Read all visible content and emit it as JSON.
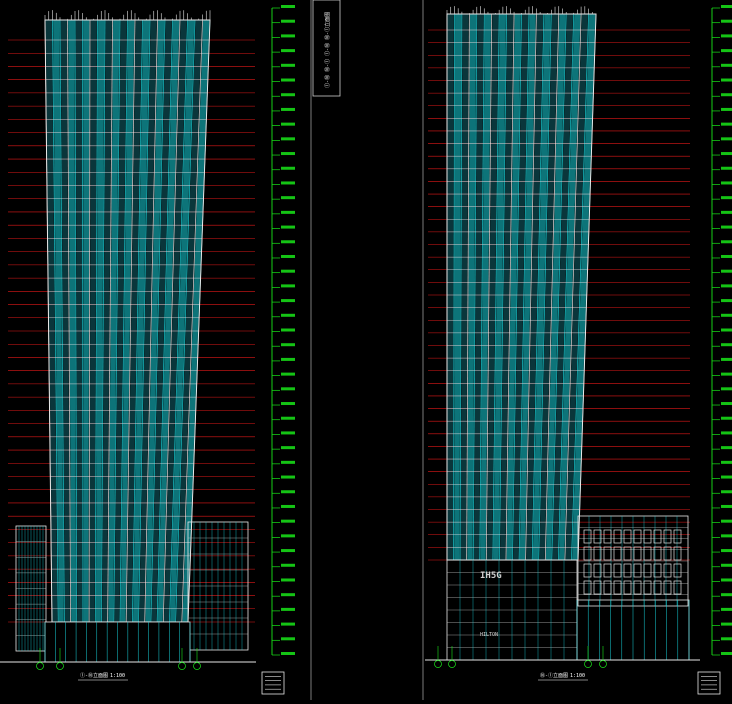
{
  "canvas": {
    "background": "#000000",
    "colors": {
      "frame": "#ffffff",
      "glass": "#18d4dc",
      "mullion": "#1a8f9a",
      "floor_line": "#e01818",
      "level_marker": "#19e619",
      "outline": "#e8e8e8",
      "podium": "#bfbfbf"
    }
  },
  "left_elevation": {
    "caption": "①-⑩立面图",
    "scale": "1:100"
  },
  "right_elevation": {
    "caption": "⑩-①立面图",
    "scale": "1:100"
  },
  "title_block": {
    "text": "①-⑩ ⑩-① ①-⑩ ⑩-①立面图"
  },
  "signage": {
    "podium_sign": "IH5G",
    "entrance_sign": "HILTON"
  },
  "elevation_tags": {
    "count_left": 44,
    "count_right": 44
  }
}
